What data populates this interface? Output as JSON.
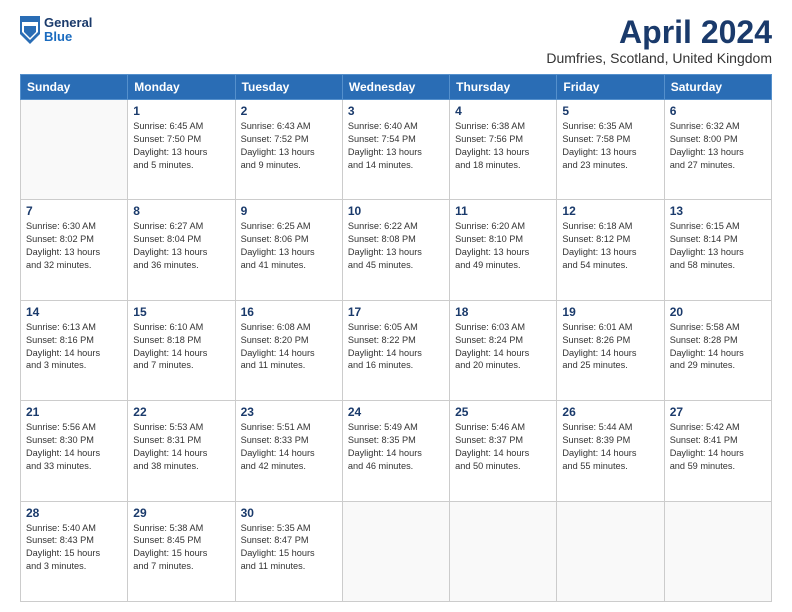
{
  "header": {
    "logo": {
      "general": "General",
      "blue": "Blue"
    },
    "title": "April 2024",
    "location": "Dumfries, Scotland, United Kingdom"
  },
  "calendar": {
    "days_of_week": [
      "Sunday",
      "Monday",
      "Tuesday",
      "Wednesday",
      "Thursday",
      "Friday",
      "Saturday"
    ],
    "weeks": [
      [
        {
          "day": "",
          "info": ""
        },
        {
          "day": "1",
          "info": "Sunrise: 6:45 AM\nSunset: 7:50 PM\nDaylight: 13 hours\nand 5 minutes."
        },
        {
          "day": "2",
          "info": "Sunrise: 6:43 AM\nSunset: 7:52 PM\nDaylight: 13 hours\nand 9 minutes."
        },
        {
          "day": "3",
          "info": "Sunrise: 6:40 AM\nSunset: 7:54 PM\nDaylight: 13 hours\nand 14 minutes."
        },
        {
          "day": "4",
          "info": "Sunrise: 6:38 AM\nSunset: 7:56 PM\nDaylight: 13 hours\nand 18 minutes."
        },
        {
          "day": "5",
          "info": "Sunrise: 6:35 AM\nSunset: 7:58 PM\nDaylight: 13 hours\nand 23 minutes."
        },
        {
          "day": "6",
          "info": "Sunrise: 6:32 AM\nSunset: 8:00 PM\nDaylight: 13 hours\nand 27 minutes."
        }
      ],
      [
        {
          "day": "7",
          "info": "Sunrise: 6:30 AM\nSunset: 8:02 PM\nDaylight: 13 hours\nand 32 minutes."
        },
        {
          "day": "8",
          "info": "Sunrise: 6:27 AM\nSunset: 8:04 PM\nDaylight: 13 hours\nand 36 minutes."
        },
        {
          "day": "9",
          "info": "Sunrise: 6:25 AM\nSunset: 8:06 PM\nDaylight: 13 hours\nand 41 minutes."
        },
        {
          "day": "10",
          "info": "Sunrise: 6:22 AM\nSunset: 8:08 PM\nDaylight: 13 hours\nand 45 minutes."
        },
        {
          "day": "11",
          "info": "Sunrise: 6:20 AM\nSunset: 8:10 PM\nDaylight: 13 hours\nand 49 minutes."
        },
        {
          "day": "12",
          "info": "Sunrise: 6:18 AM\nSunset: 8:12 PM\nDaylight: 13 hours\nand 54 minutes."
        },
        {
          "day": "13",
          "info": "Sunrise: 6:15 AM\nSunset: 8:14 PM\nDaylight: 13 hours\nand 58 minutes."
        }
      ],
      [
        {
          "day": "14",
          "info": "Sunrise: 6:13 AM\nSunset: 8:16 PM\nDaylight: 14 hours\nand 3 minutes."
        },
        {
          "day": "15",
          "info": "Sunrise: 6:10 AM\nSunset: 8:18 PM\nDaylight: 14 hours\nand 7 minutes."
        },
        {
          "day": "16",
          "info": "Sunrise: 6:08 AM\nSunset: 8:20 PM\nDaylight: 14 hours\nand 11 minutes."
        },
        {
          "day": "17",
          "info": "Sunrise: 6:05 AM\nSunset: 8:22 PM\nDaylight: 14 hours\nand 16 minutes."
        },
        {
          "day": "18",
          "info": "Sunrise: 6:03 AM\nSunset: 8:24 PM\nDaylight: 14 hours\nand 20 minutes."
        },
        {
          "day": "19",
          "info": "Sunrise: 6:01 AM\nSunset: 8:26 PM\nDaylight: 14 hours\nand 25 minutes."
        },
        {
          "day": "20",
          "info": "Sunrise: 5:58 AM\nSunset: 8:28 PM\nDaylight: 14 hours\nand 29 minutes."
        }
      ],
      [
        {
          "day": "21",
          "info": "Sunrise: 5:56 AM\nSunset: 8:30 PM\nDaylight: 14 hours\nand 33 minutes."
        },
        {
          "day": "22",
          "info": "Sunrise: 5:53 AM\nSunset: 8:31 PM\nDaylight: 14 hours\nand 38 minutes."
        },
        {
          "day": "23",
          "info": "Sunrise: 5:51 AM\nSunset: 8:33 PM\nDaylight: 14 hours\nand 42 minutes."
        },
        {
          "day": "24",
          "info": "Sunrise: 5:49 AM\nSunset: 8:35 PM\nDaylight: 14 hours\nand 46 minutes."
        },
        {
          "day": "25",
          "info": "Sunrise: 5:46 AM\nSunset: 8:37 PM\nDaylight: 14 hours\nand 50 minutes."
        },
        {
          "day": "26",
          "info": "Sunrise: 5:44 AM\nSunset: 8:39 PM\nDaylight: 14 hours\nand 55 minutes."
        },
        {
          "day": "27",
          "info": "Sunrise: 5:42 AM\nSunset: 8:41 PM\nDaylight: 14 hours\nand 59 minutes."
        }
      ],
      [
        {
          "day": "28",
          "info": "Sunrise: 5:40 AM\nSunset: 8:43 PM\nDaylight: 15 hours\nand 3 minutes."
        },
        {
          "day": "29",
          "info": "Sunrise: 5:38 AM\nSunset: 8:45 PM\nDaylight: 15 hours\nand 7 minutes."
        },
        {
          "day": "30",
          "info": "Sunrise: 5:35 AM\nSunset: 8:47 PM\nDaylight: 15 hours\nand 11 minutes."
        },
        {
          "day": "",
          "info": ""
        },
        {
          "day": "",
          "info": ""
        },
        {
          "day": "",
          "info": ""
        },
        {
          "day": "",
          "info": ""
        }
      ]
    ]
  }
}
